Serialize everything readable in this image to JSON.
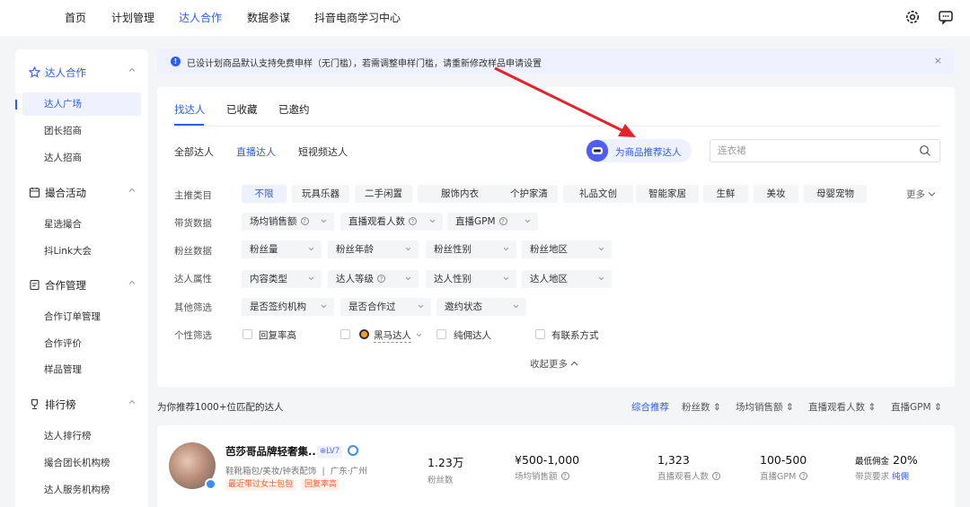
{
  "topnav": {
    "items": [
      "首页",
      "计划管理",
      "达人合作",
      "数据参谋",
      "抖音电商学习中心"
    ],
    "active_index": 2
  },
  "sidebar": {
    "groups": [
      {
        "label": "达人合作",
        "icon": "star-icon",
        "items": [
          "达人广场",
          "团长招商",
          "达人招商"
        ]
      },
      {
        "label": "撮合活动",
        "icon": "calendar-icon",
        "items": [
          "星选撮合",
          "抖Link大会"
        ]
      },
      {
        "label": "合作管理",
        "icon": "document-icon",
        "items": [
          "合作订单管理",
          "合作评价",
          "样品管理"
        ]
      },
      {
        "label": "排行榜",
        "icon": "trophy-icon",
        "items": [
          "达人排行榜",
          "撮合团长机构榜",
          "达人服务机构榜"
        ]
      }
    ],
    "active_item": "达人广场"
  },
  "notice": {
    "text": "已设计划商品默认支持免费申样（无门槛），若需调整申样门槛，请重新修改样品申请设置",
    "close": "×"
  },
  "panel": {
    "tabs": [
      "找达人",
      "已收藏",
      "已邀约"
    ],
    "subtabs": [
      "全部达人",
      "直播达人",
      "短视频达人"
    ],
    "recommend_button": "为商品推荐达人",
    "search_placeholder": "连衣裙",
    "filters": {
      "category_label": "主推类目",
      "categories": [
        "不限",
        "玩具乐器",
        "二手闲置",
        "服饰内衣",
        "个护家清",
        "礼品文创",
        "智能家居",
        "生鲜",
        "美妆",
        "母婴宠物"
      ],
      "more": "更多",
      "sales_label": "带货数据",
      "sales": [
        "场均销售额",
        "直播观看人数",
        "直播GPM"
      ],
      "fans_label": "粉丝数据",
      "fans": [
        "粉丝量",
        "粉丝年龄",
        "粉丝性别",
        "粉丝地区"
      ],
      "attr_label": "达人属性",
      "attr": [
        "内容类型",
        "达人等级",
        "达人性别",
        "达人地区"
      ],
      "other_label": "其他筛选",
      "other": [
        "是否签约机构",
        "是否合作过",
        "邀约状态"
      ],
      "personal_label": "个性筛选",
      "personal": [
        "回复率高",
        "黑马达人",
        "纯佣达人",
        "有联系方式"
      ],
      "collapse": "收起更多"
    }
  },
  "results": {
    "header": "为你推荐1000+位匹配的达人",
    "sorts": [
      "综合推荐",
      "粉丝数",
      "场均销售额",
      "直播观看人数",
      "直播GPM"
    ],
    "card": {
      "name": "芭莎哥品牌轻奢集...",
      "level": "LV7",
      "categories": "鞋靴箱包/美妆/钟表配饰",
      "location": "广东·广州",
      "tags": [
        "最近带过女士包包",
        "回复率高"
      ],
      "fans_value": "1.23万",
      "fans_label": "粉丝数",
      "sales_value": "¥500-1,000",
      "sales_label": "场均销售额",
      "viewers_value": "1,323",
      "viewers_label": "直播观看人数",
      "gpm_value": "100-500",
      "gpm_label": "直播GPM",
      "commission_prefix": "最低佣金",
      "commission_value": "20%",
      "requirement_label": "带货要求",
      "requirement_value": "纯佣"
    }
  },
  "colors": {
    "accent": "#2e5cf6",
    "arrow": "#e8202a",
    "tag": "#f55d2e"
  }
}
